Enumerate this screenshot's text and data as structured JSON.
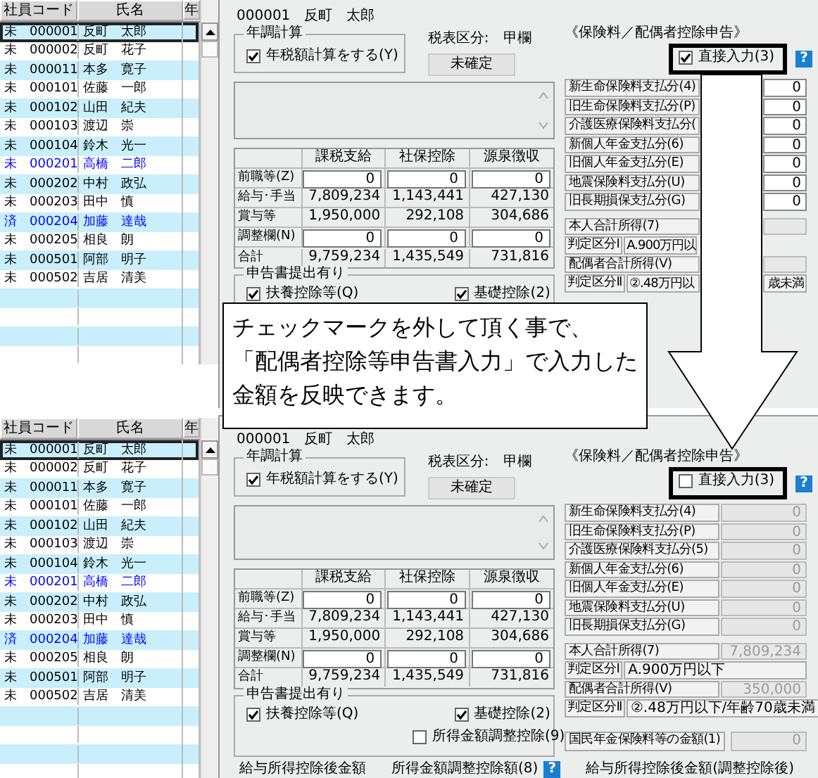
{
  "screens": [
    {
      "employee_list": {
        "columns": [
          "社員コード",
          "氏名",
          "年"
        ],
        "rows": [
          {
            "status": "未",
            "code": "000001",
            "name": "反町　太郎",
            "selected": true,
            "color": "#000000"
          },
          {
            "status": "未",
            "code": "000002",
            "name": "反町　花子",
            "selected": false,
            "color": "#000000"
          },
          {
            "status": "未",
            "code": "000011",
            "name": "本多　寛子",
            "selected": false,
            "color": "#000000"
          },
          {
            "status": "未",
            "code": "000101",
            "name": "佐藤　一郎",
            "selected": false,
            "color": "#000000"
          },
          {
            "status": "未",
            "code": "000102",
            "name": "山田　紀夫",
            "selected": false,
            "color": "#000000"
          },
          {
            "status": "未",
            "code": "000103",
            "name": "渡辺　崇",
            "selected": false,
            "color": "#000000"
          },
          {
            "status": "未",
            "code": "000104",
            "name": "鈴木　光一",
            "selected": false,
            "color": "#000000"
          },
          {
            "status": "未",
            "code": "000201",
            "name": "高橋　二郎",
            "selected": false,
            "color": "#0000ff"
          },
          {
            "status": "未",
            "code": "000202",
            "name": "中村　政弘",
            "selected": false,
            "color": "#000000"
          },
          {
            "status": "未",
            "code": "000203",
            "name": "田中　慎",
            "selected": false,
            "color": "#000000"
          },
          {
            "status": "済",
            "code": "000204",
            "name": "加藤　達哉",
            "selected": false,
            "color": "#0000ff"
          },
          {
            "status": "未",
            "code": "000205",
            "name": "相良　朗",
            "selected": false,
            "color": "#000000"
          },
          {
            "status": "未",
            "code": "000501",
            "name": "阿部　明子",
            "selected": false,
            "color": "#000000"
          },
          {
            "status": "未",
            "code": "000502",
            "name": "吉居　清美",
            "selected": false,
            "color": "#000000"
          }
        ]
      },
      "form": {
        "employee": "000001　反町　太郎",
        "year_end": {
          "title": "年調計算",
          "checkbox": {
            "label": "年税額計算をする(Y)",
            "checked": true
          }
        },
        "tax_table": {
          "label": "税表区分:　甲欄",
          "status": "未確定"
        },
        "table": {
          "columns": [
            "課税支給",
            "社保控除",
            "源泉徴収"
          ],
          "rows": [
            {
              "label": "前職等(Z)",
              "kind": "input",
              "cells": [
                "0",
                "0",
                "0"
              ]
            },
            {
              "label": "給与･手当",
              "kind": "text",
              "cells": [
                "7,809,234",
                "1,143,441",
                "427,130"
              ]
            },
            {
              "label": "賞与等",
              "kind": "text",
              "cells": [
                "1,950,000",
                "292,108",
                "304,686"
              ]
            },
            {
              "label": "調整欄(N)",
              "kind": "input",
              "cells": [
                "0",
                "0",
                "0"
              ]
            },
            {
              "label": "合計",
              "kind": "text",
              "cells": [
                "9,759,234",
                "1,435,549",
                "731,816"
              ]
            }
          ]
        },
        "declaration": {
          "title": "申告書提出有り",
          "checkboxes": [
            {
              "label": "扶養控除等(Q)",
              "checked": true
            },
            {
              "label": "基礎控除(2)",
              "checked": true
            }
          ]
        },
        "insurance": {
          "title": "《保険料／配偶者控除申告》",
          "direct_input": {
            "label": "直接入力(3)",
            "checked": true
          },
          "help": "?",
          "rows": [
            {
              "label": "新生命保険料支払分(4)",
              "value": "0"
            },
            {
              "label": "旧生命保険料支払分(P)",
              "value": "0"
            },
            {
              "label": "介護医療保険料支払分(",
              "value": "0"
            },
            {
              "label": "新個人年金支払分(6)",
              "value": "0"
            },
            {
              "label": "旧個人年金支払分(E)",
              "value": "0"
            },
            {
              "label": "地震保険料支払分(U)",
              "value": "0"
            },
            {
              "label": "旧長期損保支払分(G)",
              "value": "0"
            }
          ]
        },
        "income": [
          {
            "kind": "amount",
            "label": "本人合計所得(7)"
          },
          {
            "kind": "class",
            "label": "判定区分Ⅰ",
            "value": "A.900万円以"
          },
          {
            "kind": "amount",
            "label": "配偶者合計所得(V)"
          },
          {
            "kind": "class",
            "label": "判定区分Ⅱ",
            "value": "②.48万円以",
            "value_tail": "歳未満"
          }
        ]
      }
    },
    {
      "employee_list": {
        "columns": [
          "社員コード",
          "氏名",
          "年"
        ],
        "rows": [
          {
            "status": "未",
            "code": "000001",
            "name": "反町　太郎",
            "selected": true,
            "color": "#000000"
          },
          {
            "status": "未",
            "code": "000002",
            "name": "反町　花子",
            "selected": false,
            "color": "#000000"
          },
          {
            "status": "未",
            "code": "000011",
            "name": "本多　寛子",
            "selected": false,
            "color": "#000000"
          },
          {
            "status": "未",
            "code": "000101",
            "name": "佐藤　一郎",
            "selected": false,
            "color": "#000000"
          },
          {
            "status": "未",
            "code": "000102",
            "name": "山田　紀夫",
            "selected": false,
            "color": "#000000"
          },
          {
            "status": "未",
            "code": "000103",
            "name": "渡辺　崇",
            "selected": false,
            "color": "#000000"
          },
          {
            "status": "未",
            "code": "000104",
            "name": "鈴木　光一",
            "selected": false,
            "color": "#000000"
          },
          {
            "status": "未",
            "code": "000201",
            "name": "高橋　二郎",
            "selected": false,
            "color": "#0000ff"
          },
          {
            "status": "未",
            "code": "000202",
            "name": "中村　政弘",
            "selected": false,
            "color": "#000000"
          },
          {
            "status": "未",
            "code": "000203",
            "name": "田中　慎",
            "selected": false,
            "color": "#000000"
          },
          {
            "status": "済",
            "code": "000204",
            "name": "加藤　達哉",
            "selected": false,
            "color": "#0000ff"
          },
          {
            "status": "未",
            "code": "000205",
            "name": "相良　朗",
            "selected": false,
            "color": "#000000"
          },
          {
            "status": "未",
            "code": "000501",
            "name": "阿部　明子",
            "selected": false,
            "color": "#000000"
          },
          {
            "status": "未",
            "code": "000502",
            "name": "吉居　清美",
            "selected": false,
            "color": "#000000"
          }
        ]
      },
      "form": {
        "employee": "000001　反町　太郎",
        "year_end": {
          "title": "年調計算",
          "checkbox": {
            "label": "年税額計算をする(Y)",
            "checked": true
          }
        },
        "tax_table": {
          "label": "税表区分:　甲欄",
          "status": "未確定"
        },
        "table": {
          "columns": [
            "課税支給",
            "社保控除",
            "源泉徴収"
          ],
          "rows": [
            {
              "label": "前職等(Z)",
              "kind": "input",
              "cells": [
                "0",
                "0",
                "0"
              ]
            },
            {
              "label": "給与･手当",
              "kind": "text",
              "cells": [
                "7,809,234",
                "1,143,441",
                "427,130"
              ]
            },
            {
              "label": "賞与等",
              "kind": "text",
              "cells": [
                "1,950,000",
                "292,108",
                "304,686"
              ]
            },
            {
              "label": "調整欄(N)",
              "kind": "input",
              "cells": [
                "0",
                "0",
                "0"
              ]
            },
            {
              "label": "合計",
              "kind": "text",
              "cells": [
                "9,759,234",
                "1,435,549",
                "731,816"
              ]
            }
          ]
        },
        "declaration": {
          "title": "申告書提出有り",
          "checkboxes": [
            {
              "label": "扶養控除等(Q)",
              "checked": true
            },
            {
              "label": "基礎控除(2)",
              "checked": true
            },
            {
              "label": "所得金額調整控除(9)",
              "checked": false
            }
          ]
        },
        "insurance": {
          "title": "《保険料／配偶者控除申告》",
          "direct_input": {
            "label": "直接入力(3)",
            "checked": false
          },
          "help": "?",
          "rows": [
            {
              "label": "新生命保険料支払分(4)",
              "value": "0"
            },
            {
              "label": "旧生命保険料支払分(P)",
              "value": "0"
            },
            {
              "label": "介護医療保険料支払分(5)",
              "value": "0"
            },
            {
              "label": "新個人年金支払分(6)",
              "value": "0"
            },
            {
              "label": "旧個人年金支払分(E)",
              "value": "0"
            },
            {
              "label": "地震保険料支払分(U)",
              "value": "0"
            },
            {
              "label": "旧長期損保支払分(G)",
              "value": "0"
            }
          ]
        },
        "income": [
          {
            "kind": "amount",
            "label": "本人合計所得(7)",
            "value": "7,809,234"
          },
          {
            "kind": "class",
            "label": "判定区分Ⅰ",
            "value": "A.900万円以下"
          },
          {
            "kind": "amount",
            "label": "配偶者合計所得(V)",
            "value": "350,000"
          },
          {
            "kind": "class",
            "label": "判定区分Ⅱ",
            "value": "②.48万円以下/年齢70歳未満"
          }
        ],
        "pension": {
          "label": "国民年金保険料等の金額(1)",
          "value": "0"
        },
        "footer": [
          {
            "label": "給与所得控除後金額"
          },
          {
            "label": "所得金額調整控除額(8)",
            "help": "?"
          },
          {
            "label": "給与所得控除後金額(調整控除後)"
          }
        ]
      }
    }
  ],
  "callout": {
    "lines": [
      "チェックマークを外して頂く事で、",
      "「配偶者控除等申告書入力」で入力した",
      "金額を反映できます。"
    ]
  }
}
